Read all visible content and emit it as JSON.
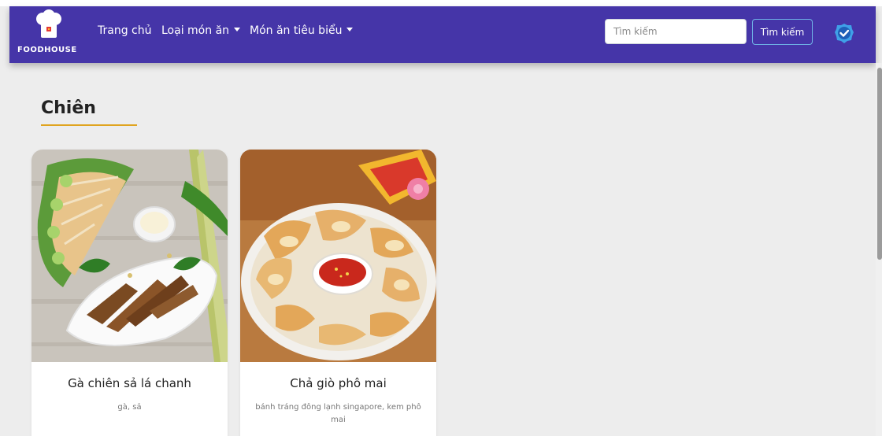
{
  "navbar": {
    "brand": "FOODHOUSE",
    "links": [
      {
        "label": "Trang chủ",
        "dropdown": false
      },
      {
        "label": "Loại món ăn",
        "dropdown": true
      },
      {
        "label": "Món ăn tiêu biểu",
        "dropdown": true
      }
    ],
    "search_placeholder": "Tìm kiếm",
    "search_button": "Tìm kiếm",
    "color": "#4535a8"
  },
  "section": {
    "title": "Chiên",
    "accent": "#e0a41f"
  },
  "cards": [
    {
      "title": "Gà chiên sả lá chanh",
      "description": "gà, sả"
    },
    {
      "title": "Chả giò phô mai",
      "description": "bánh tráng đông lạnh singapore, kem phô mai"
    }
  ]
}
